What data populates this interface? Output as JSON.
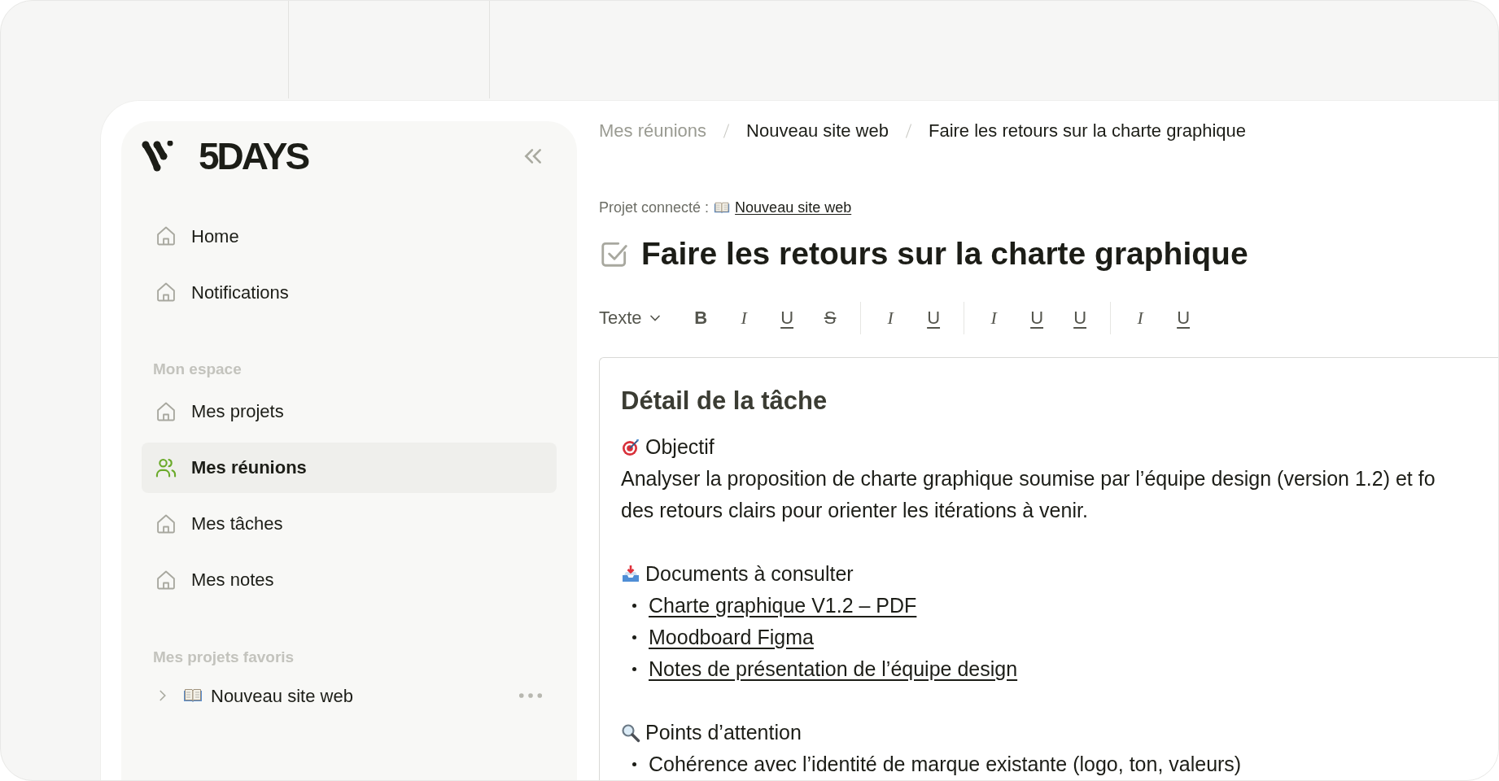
{
  "sidebar": {
    "logo": "5DAYS",
    "items": [
      {
        "label": "Home",
        "selected": false
      },
      {
        "label": "Notifications",
        "selected": false
      }
    ],
    "sections": [
      {
        "title": "Mon espace",
        "items": [
          {
            "label": "Mes projets",
            "selected": false
          },
          {
            "label": "Mes réunions",
            "selected": true
          },
          {
            "label": "Mes tâches",
            "selected": false
          },
          {
            "label": "Mes notes",
            "selected": false
          }
        ]
      },
      {
        "title": "Mes projets favoris",
        "favorites": [
          {
            "label": "Nouveau site web",
            "expanded": false
          }
        ]
      }
    ]
  },
  "breadcrumb": [
    "Mes réunions",
    "Nouveau site web",
    "Faire les retours sur la charte graphique"
  ],
  "connected_project": {
    "label": "Projet connecté :",
    "project": "Nouveau site web"
  },
  "task": {
    "title": "Faire les retours sur la charte graphique",
    "done": true
  },
  "toolbar": {
    "text_style": "Texte",
    "groups": [
      [
        {
          "kind": "bold",
          "label": "B"
        },
        {
          "kind": "italic",
          "label": "I"
        },
        {
          "kind": "underline",
          "label": "U"
        },
        {
          "kind": "strike",
          "label": "S"
        }
      ],
      [
        {
          "kind": "italic",
          "label": "I"
        },
        {
          "kind": "underline",
          "label": "U"
        }
      ],
      [
        {
          "kind": "italic",
          "label": "I"
        },
        {
          "kind": "underline",
          "label": "U"
        },
        {
          "kind": "underline",
          "label": "U"
        }
      ],
      [
        {
          "kind": "italic",
          "label": "I"
        },
        {
          "kind": "underline",
          "label": "U"
        }
      ]
    ]
  },
  "editor": {
    "heading": "Détail de la tâche",
    "blocks": [
      {
        "kind": "section",
        "title": "Objectif",
        "lines": [
          "Analyser la proposition de charte graphique soumise par l’équipe design (version 1.2) et fo",
          "des retours clairs pour orienter les itérations à venir."
        ]
      },
      {
        "kind": "section",
        "title": "Documents à consulter",
        "links": [
          "Charte graphique V1.2 – PDF",
          "Moodboard Figma",
          "Notes de présentation de l’équipe design"
        ]
      },
      {
        "kind": "section",
        "title": "Points d’attention",
        "bullets": [
          "Cohérence avec l’identité de marque existante (logo, ton, valeurs)"
        ]
      }
    ]
  }
}
